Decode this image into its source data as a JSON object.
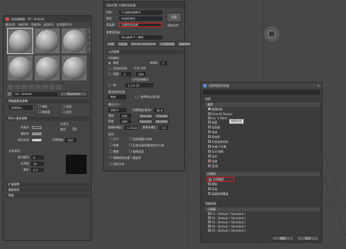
{
  "viewport": {
    "nav_cube_icon": "stop-square-icon"
  },
  "mat_editor": {
    "title": "材质编辑器 - 04 - Default",
    "menu": [
      "模式(D)",
      "材质(M)",
      "导航(N)",
      "选项(O)",
      "实用程序(U)"
    ],
    "slot_name": "04 - Default",
    "type_button": "Standard",
    "shader_rollout": "明暗器基本参数",
    "shader_value": "(B)Blinn",
    "shader_options": [
      "线框",
      "双面",
      "面贴图",
      "面状"
    ],
    "blinn_rollout": "Blinn 基本参数",
    "self_illum": "自发光",
    "ambient": "环境光:",
    "diffuse": "漫反射:",
    "specular": "高光反射:",
    "color_label": "颜色",
    "opacity": "不透明度:",
    "opacity_value": "100",
    "highlights": "反射高光",
    "spec_level": "高光级别:",
    "gloss": "光泽度:",
    "soften": "柔化:",
    "spec_level_value": "0",
    "gloss_value": "10",
    "soften_value": "0.1",
    "rollouts": [
      "扩展参数",
      "超级采样",
      "贴图"
    ]
  },
  "render_setup": {
    "title": "渲染设置: 扫描线渲染器",
    "target_label": "目标:",
    "target_value": "产品级渲染模式",
    "preset_label": "预设:",
    "preset_value": "未选定预设",
    "renderer_label": "渲染器:",
    "renderer_value": "扫描线渲染器",
    "render_button": "渲染",
    "save_file": "保存文件",
    "view_label": "查看到渲染:",
    "view_value": "四元菜单 4 - 透视",
    "tabs": [
      "公用",
      "渲染器",
      "Render Elements",
      "光线跟踪器",
      "高级照明"
    ],
    "common_rollout": "公用参数",
    "time_output": "时间输出",
    "single": "单帧",
    "every_n": "每N帧:",
    "every_n_value": "1",
    "active_segment": "活动时间段:",
    "active_value": "0 到 100",
    "range": "范围:",
    "range_from": "0",
    "range_to": "100",
    "frames": "帧:",
    "frames_value": "1,3,5-12",
    "file_start": "文件起始编号:",
    "area_label": "要渲染的区域",
    "area_value": "视图",
    "auto_region": "选择的自动区域",
    "output_size": "输出大小",
    "custom": "自定义",
    "aperture": "光圈宽度(毫米):",
    "aperture_value": "36.0",
    "width_label": "宽度:",
    "width_value": "640",
    "height_label": "高度:",
    "height_value": "480",
    "size_buttons": [
      "320x240",
      "720x486",
      "640x480",
      "800x600"
    ],
    "image_aspect": "图像纵横比:",
    "image_aspect_value": "1.33333",
    "pixel_aspect": "像素纵横比:",
    "pixel_aspect_value": "1.0",
    "options_label": "选项",
    "options": [
      "大气",
      "渲染隐藏几何体",
      "效果",
      "区域光源/阴影视作点光源",
      "置换",
      "强制双面",
      "视频颜色检查",
      "超级黑",
      "渲染为场"
    ]
  },
  "browser": {
    "title": "材质/贴图浏览器",
    "search_placeholder": "按名称搜索...",
    "section_materials": "材质",
    "general_group": "通用",
    "items": [
      "物理材质",
      "DirectX Shader",
      "Ink 'n Paint",
      "双面",
      "变形器",
      "合成",
      "壳材质",
      "外部参照材质",
      "多维/子对象",
      "无光/投影",
      "混合",
      "虫漆",
      "顶/底"
    ],
    "tooltip": "物理材质",
    "scanline_group": "扫描线",
    "scanline_items": [
      "光线跟踪",
      "建筑",
      "标准",
      "高级照明覆盖"
    ],
    "highlighted_item": "光线跟踪",
    "scene_section": "场景材质",
    "scene_group": "示例窗",
    "scene_items": [
      "01 - Default ( Standard )",
      "02 - Default ( Standard )",
      "03 - Default ( Standard )",
      "04 - Default ( Standard )",
      "05 - Default ( Standard )"
    ],
    "ok": "确定",
    "cancel": "取消"
  }
}
